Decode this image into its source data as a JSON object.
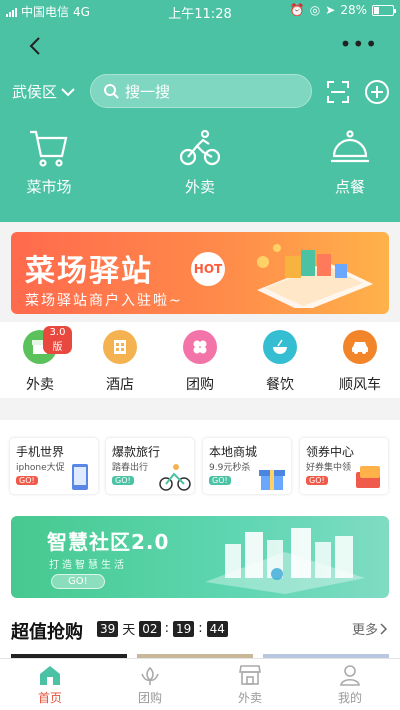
{
  "status_bar": {
    "carrier": "中国电信",
    "network": "4G",
    "time": "上午11:28",
    "battery": "28%",
    "battery_level": 0.28
  },
  "header": {
    "location": "武侯区",
    "search_placeholder": "搜一搜"
  },
  "top_nav": [
    {
      "label": "菜市场",
      "icon": "basket-icon"
    },
    {
      "label": "外卖",
      "icon": "bike-icon"
    },
    {
      "label": "点餐",
      "icon": "cloche-icon"
    }
  ],
  "banner1": {
    "title": "菜场驿站",
    "subtitle": "菜场驿站商户入驻啦~",
    "hot": "HOT"
  },
  "services": [
    {
      "label": "外卖",
      "badge": "3.0版",
      "color": "#5bc15a"
    },
    {
      "label": "酒店",
      "color": "#f4b251"
    },
    {
      "label": "团购",
      "color": "#f274a8"
    },
    {
      "label": "餐饮",
      "color": "#35bed1"
    },
    {
      "label": "顺风车",
      "color": "#f2842a"
    }
  ],
  "promo_cards": [
    {
      "title": "手机世界",
      "sub": "iphone大促",
      "go": "GO!"
    },
    {
      "title": "爆款旅行",
      "sub": "踏春出行",
      "go": "GO!"
    },
    {
      "title": "本地商城",
      "sub": "9.9元秒杀",
      "go": "GO!"
    },
    {
      "title": "领券中心",
      "sub": "好券集中领",
      "go": "GO!"
    }
  ],
  "banner2": {
    "title": "智慧社区2.0",
    "subtitle": "打造智慧生活",
    "go": "GO!"
  },
  "flash_sale": {
    "title": "超值抢购",
    "days": "39",
    "day_unit": "天",
    "hours": "02",
    "minutes": "19",
    "seconds": "44",
    "sep": ":",
    "more": "更多"
  },
  "tab_bar": [
    {
      "label": "首页",
      "icon": "home-icon",
      "active": true
    },
    {
      "label": "团购",
      "icon": "flower-icon",
      "active": false
    },
    {
      "label": "外卖",
      "icon": "shop-icon",
      "active": false
    },
    {
      "label": "我的",
      "icon": "user-icon",
      "active": false
    }
  ],
  "colors": {
    "primary": "#4cc2a4",
    "accent": "#e6533d"
  }
}
